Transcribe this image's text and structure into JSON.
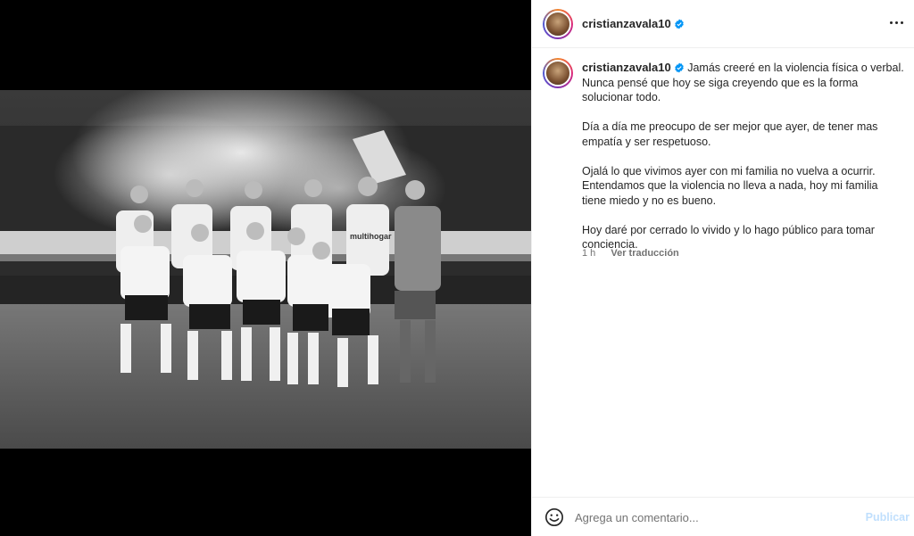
{
  "post": {
    "username": "cristianzavala10",
    "caption": {
      "intro": "Jamás creeré en la violencia física o verbal. Nunca pensé que hoy se siga creyendo que es la forma solucionar todo.",
      "paragraphs": [
        "Día a día me preocupo de ser mejor que ayer, de tener mas empatía y ser respetuoso.",
        "Ojalá lo que vivimos ayer con mi familia no vuelva a ocurrir. Entendamos que la violencia no lleva a nada, hoy mi familia tiene miedo y no es bueno.",
        "Hoy daré por cerrado lo vivido y lo hago público para tomar conciencia."
      ]
    },
    "time": "1 h",
    "translate_label": "Ver traducción"
  },
  "comment": {
    "placeholder": "Agrega un comentario...",
    "publish_label": "Publicar"
  },
  "photo": {
    "sponsor": "multihogar"
  },
  "colors": {
    "verified": "#0095f6",
    "publish_disabled": "#c0dffd"
  },
  "icons": [
    "verified-icon",
    "more-options-icon",
    "emoji-icon"
  ]
}
